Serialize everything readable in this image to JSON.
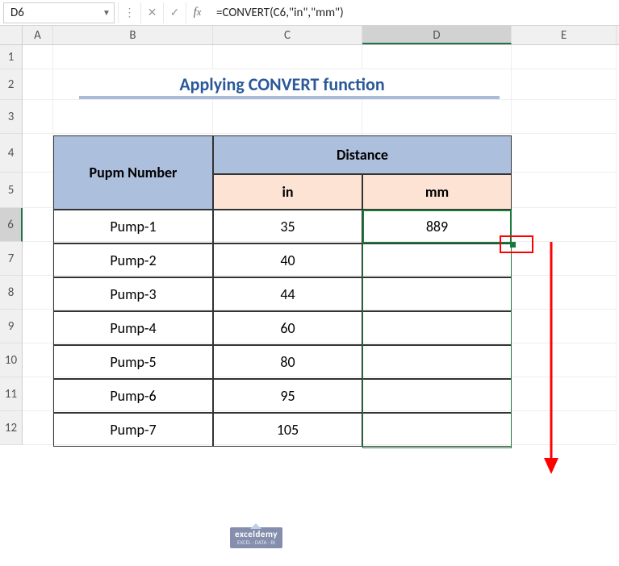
{
  "namebox": "D6",
  "formula": "=CONVERT(C6,\"in\",\"mm\")",
  "columns": [
    "A",
    "B",
    "C",
    "D",
    "E"
  ],
  "rows": [
    "1",
    "2",
    "3",
    "4",
    "5",
    "6",
    "7",
    "8",
    "9",
    "10",
    "11",
    "12"
  ],
  "title": "Applying CONVERT function",
  "table": {
    "header_main": "Pupm Number",
    "header_dist": "Distance",
    "sub_in": "in",
    "sub_mm": "mm",
    "data": [
      {
        "name": "Pump-1",
        "in": "35",
        "mm": "889"
      },
      {
        "name": "Pump-2",
        "in": "40",
        "mm": ""
      },
      {
        "name": "Pump-3",
        "in": "44",
        "mm": ""
      },
      {
        "name": "Pump-4",
        "in": "60",
        "mm": ""
      },
      {
        "name": "Pump-5",
        "in": "80",
        "mm": ""
      },
      {
        "name": "Pump-6",
        "in": "95",
        "mm": ""
      },
      {
        "name": "Pump-7",
        "in": "105",
        "mm": ""
      }
    ]
  },
  "watermark": {
    "name": "exceldemy",
    "sub": "EXCEL · DATA · BI"
  }
}
